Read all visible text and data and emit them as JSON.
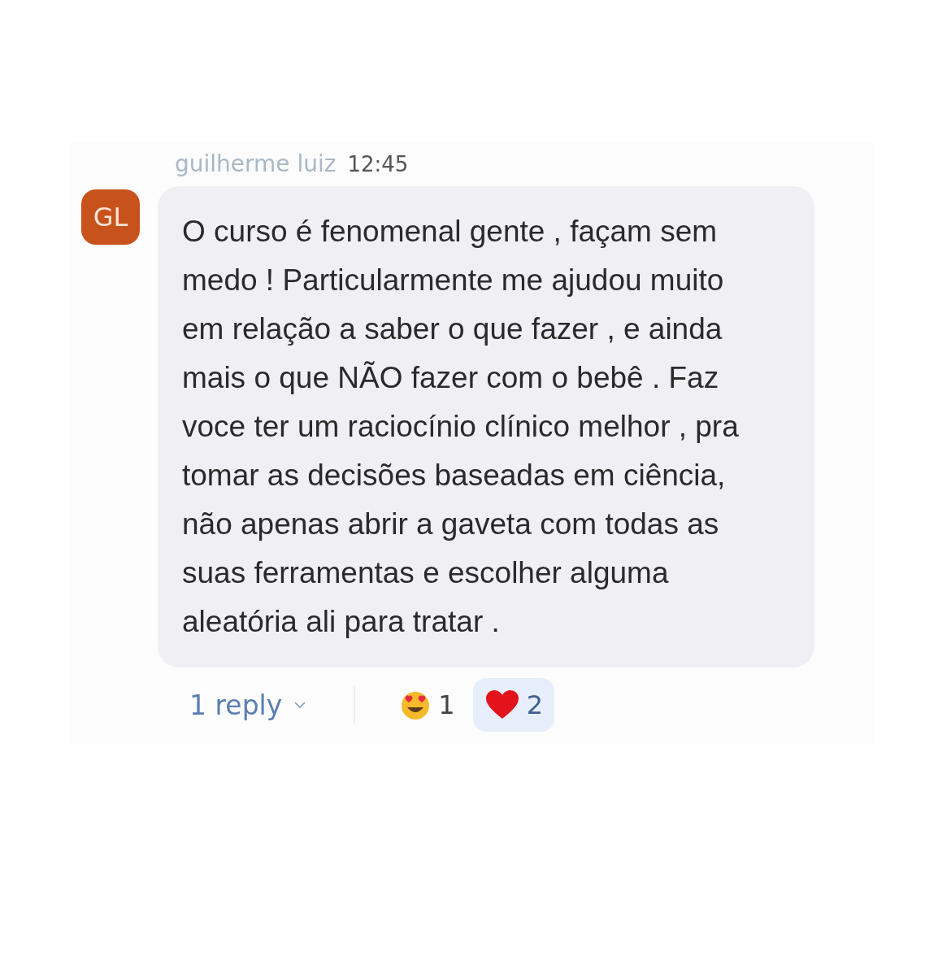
{
  "message": {
    "author": "guilherme luiz",
    "time": "12:45",
    "avatar_initials": "GL",
    "text": "O curso é fenomenal gente , façam sem medo ! Particularmente me ajudou muito em relação a saber o que fazer , e ainda mais o que NÃO fazer com o bebê . Faz voce ter um raciocínio clínico melhor , pra tomar as decisões baseadas em ciência, não apenas abrir a gaveta com todas as suas ferramentas e escolher alguma aleatória ali para tratar ."
  },
  "replies": {
    "label": "1 reply"
  },
  "reactions": [
    {
      "kind": "heart-eyes",
      "count": "1",
      "selected": false
    },
    {
      "kind": "heart",
      "count": "2",
      "selected": true
    }
  ]
}
